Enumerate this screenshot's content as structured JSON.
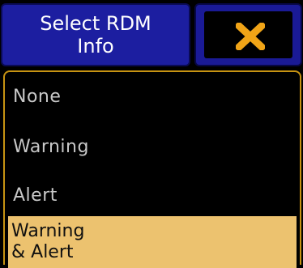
{
  "dialog": {
    "title": "Select RDM Info",
    "close_icon": "close-x-icon"
  },
  "options": [
    {
      "label": "None",
      "selected": false
    },
    {
      "label": "Warning",
      "selected": false
    },
    {
      "label": "Alert",
      "selected": false
    },
    {
      "label": "Warning & Alert",
      "selected": true
    }
  ],
  "colors": {
    "title_bg": "#1c1ea0",
    "close_icon": "#f0a417",
    "list_border": "#c79312",
    "selected_bg": "#ecc26f",
    "item_text": "#c8c8c8"
  }
}
